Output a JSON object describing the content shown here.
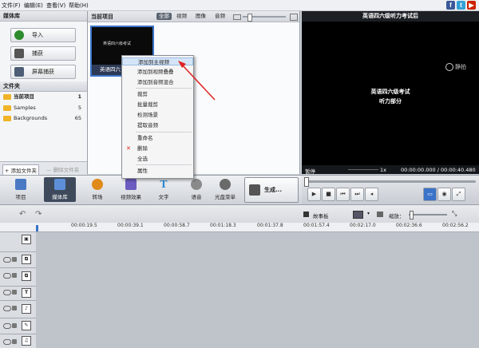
{
  "menubar": {
    "items": [
      "文件(F)",
      "编辑(E)",
      "查看(V)",
      "帮助(H)"
    ],
    "social": [
      {
        "name": "facebook-icon",
        "glyph": "f",
        "color": "#3b5998"
      },
      {
        "name": "twitter-icon",
        "glyph": "t",
        "color": "#33a1d6"
      },
      {
        "name": "youtube-icon",
        "glyph": "▶",
        "color": "#cc2200"
      }
    ]
  },
  "media_library": {
    "title": "媒体库",
    "import_label": "导入",
    "capture_label": "捕获",
    "screen_capture_label": "屏幕捕获",
    "folders_title": "文件夹",
    "folders": [
      {
        "name": "当前项目",
        "count": "1"
      },
      {
        "name": "Samples",
        "count": "5"
      },
      {
        "name": "Backgrounds",
        "count": "65"
      }
    ],
    "add_folder_label": "+ 添加文件夹",
    "delete_folder_label": "— 删除文件夹"
  },
  "current_project": {
    "title": "当前项目",
    "filters": [
      "全部",
      "视频",
      "图像",
      "音频"
    ],
    "clip_label": "英语四六",
    "clip_thumb_text": "英语四六级考试"
  },
  "context_menu": {
    "items": [
      "添加到主视频",
      "添加到视频叠叠",
      "添加到音频混合",
      "裁剪",
      "批量裁剪",
      "检测场景",
      "提取音频",
      "重命名",
      "删除",
      "全选",
      "属性"
    ]
  },
  "preview": {
    "title": "英语四六级听力考试后",
    "video_line1": "英语四六级考试",
    "video_line2": "听力部分",
    "watermark": "静拍",
    "status": "暂停",
    "speed": "1x",
    "time": "00:00:00.000 / 00:00:40.480"
  },
  "toolbar": {
    "items": [
      {
        "label": "项目",
        "color": "#4a79c4"
      },
      {
        "label": "媒体库",
        "color": "#3a6fb5"
      },
      {
        "label": "转场",
        "color": "#e08a1b"
      },
      {
        "label": "视频效果",
        "color": "#6c5cc0"
      },
      {
        "label": "文字",
        "color": "#2f8bd3"
      },
      {
        "label": "语音",
        "color": "#8a8a8a"
      },
      {
        "label": "光盘菜单",
        "color": "#6a6a6a"
      }
    ],
    "produce_label": "生成..."
  },
  "timeline": {
    "storyboard_label": "故事板",
    "zoom_label": "缩放：",
    "ruler": [
      "00:00:19.5",
      "00:00:39.1",
      "00:00:58.7",
      "00:01:18.3",
      "00:01:37.8",
      "00:01:57.4",
      "00:02:17.0",
      "00:02:36.6",
      "00:02:56.2"
    ]
  }
}
